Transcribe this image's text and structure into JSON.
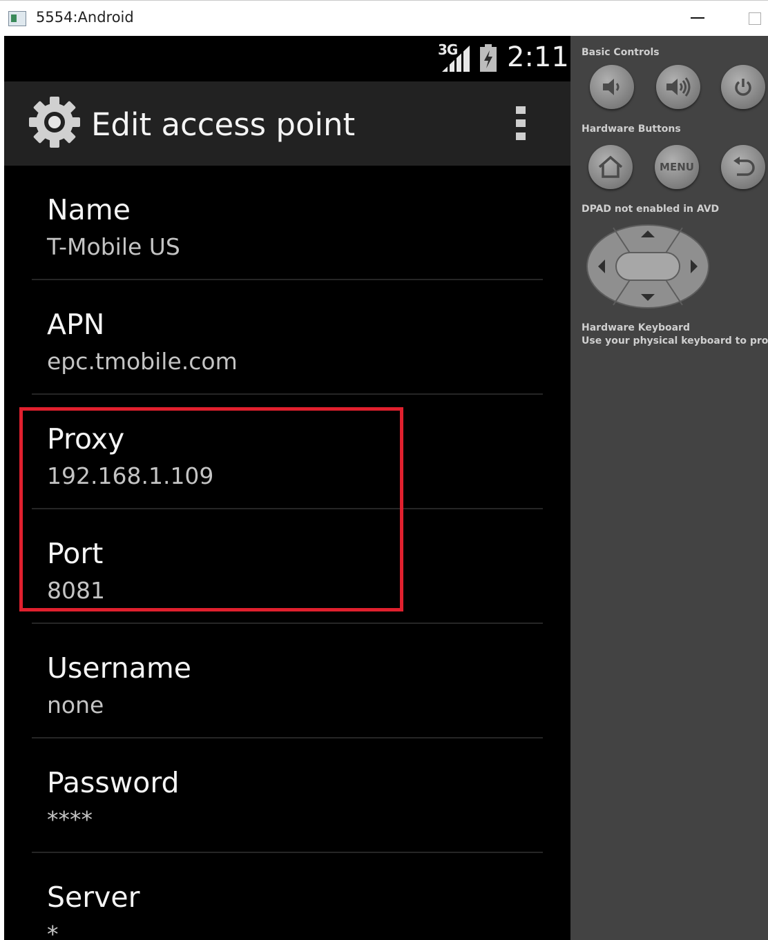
{
  "window": {
    "title": "5554:Android"
  },
  "status_bar": {
    "network": "3G",
    "time": "2:11"
  },
  "action_bar": {
    "title": "Edit access point"
  },
  "preferences": [
    {
      "title": "Name",
      "summary": "T-Mobile US"
    },
    {
      "title": "APN",
      "summary": "epc.tmobile.com"
    },
    {
      "title": "Proxy",
      "summary": "192.168.1.109"
    },
    {
      "title": "Port",
      "summary": "8081"
    },
    {
      "title": "Username",
      "summary": "none"
    },
    {
      "title": "Password",
      "summary": "****"
    },
    {
      "title": "Server",
      "summary": "*"
    }
  ],
  "panel": {
    "basic_controls": "Basic Controls",
    "hardware_buttons": "Hardware Buttons",
    "menu_label": "MENU",
    "dpad_note": "DPAD not enabled in AVD",
    "keyboard_title": "Hardware Keyboard",
    "keyboard_desc": "Use your physical keyboard to provi"
  },
  "colors": {
    "highlight": "#e0202e",
    "action_bar": "#222222",
    "panel": "#434343"
  }
}
